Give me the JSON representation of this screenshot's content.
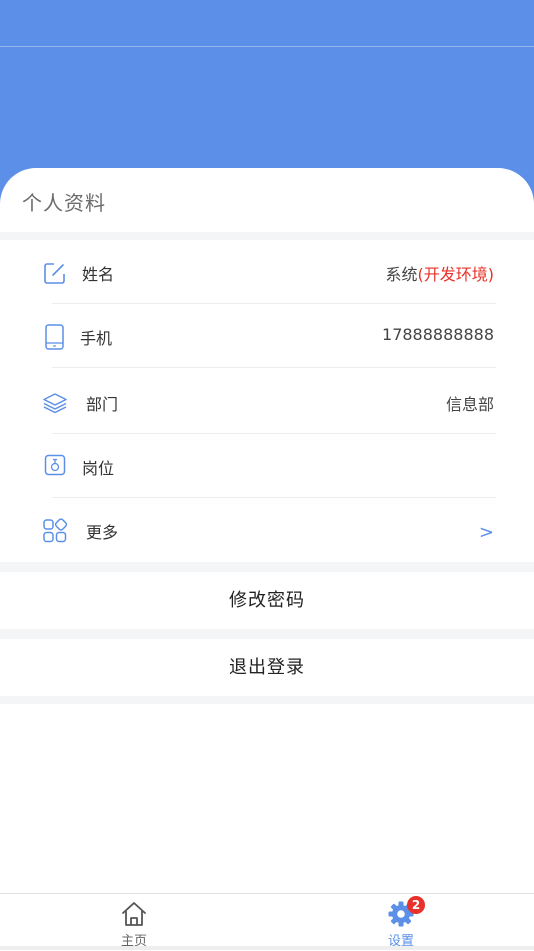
{
  "colors": {
    "header_blue": "#5b8fe8",
    "accent_red": "#e8312a",
    "icon_blue": "#5b8fe8"
  },
  "profile": {
    "title": "个人资料"
  },
  "rows": [
    {
      "icon": "edit-icon",
      "label": "姓名",
      "value": "系统",
      "value_accent": "(开发环境)"
    },
    {
      "icon": "phone-icon",
      "label": "手机",
      "value": "17888888888"
    },
    {
      "icon": "layers-icon",
      "label": "部门",
      "value": "信息部"
    },
    {
      "icon": "badge-icon",
      "label": "岗位",
      "value": ""
    },
    {
      "icon": "grid-icon",
      "label": "更多",
      "chevron": ">"
    }
  ],
  "actions": {
    "change_password": "修改密码",
    "logout": "退出登录"
  },
  "tabbar": {
    "home": {
      "label": "主页",
      "icon": "home-icon",
      "color": "#666666"
    },
    "settings": {
      "label": "设置",
      "icon": "gear-icon",
      "badge": "2",
      "color": "#5b8fe8"
    }
  }
}
